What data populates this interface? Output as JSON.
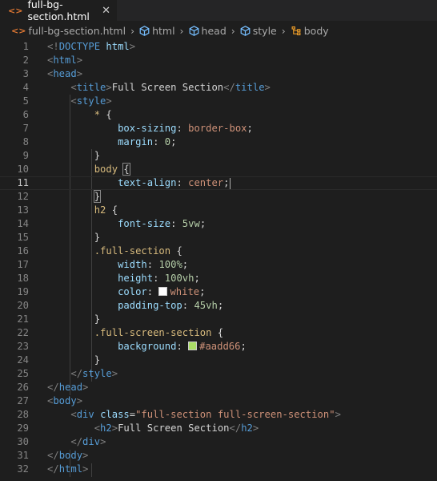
{
  "tab": {
    "filename": "full-bg-section.html",
    "file_icon": "html-file-icon",
    "close_icon": "close-icon",
    "close_glyph": "✕"
  },
  "breadcrumb": {
    "file": "full-bg-section.html",
    "items": [
      "html",
      "head",
      "style",
      "body"
    ],
    "separator": "›"
  },
  "colors": {
    "white_swatch": "#ffffff",
    "green_swatch": "#aadd66"
  },
  "editor": {
    "current_line": 11,
    "lines": [
      {
        "n": "1"
      },
      {
        "n": "2"
      },
      {
        "n": "3"
      },
      {
        "n": "4"
      },
      {
        "n": "5"
      },
      {
        "n": "6"
      },
      {
        "n": "7"
      },
      {
        "n": "8"
      },
      {
        "n": "9"
      },
      {
        "n": "10"
      },
      {
        "n": "11"
      },
      {
        "n": "12"
      },
      {
        "n": "13"
      },
      {
        "n": "14"
      },
      {
        "n": "15"
      },
      {
        "n": "16"
      },
      {
        "n": "17"
      },
      {
        "n": "18"
      },
      {
        "n": "19"
      },
      {
        "n": "20"
      },
      {
        "n": "21"
      },
      {
        "n": "22"
      },
      {
        "n": "23"
      },
      {
        "n": "24"
      },
      {
        "n": "25"
      },
      {
        "n": "26"
      },
      {
        "n": "27"
      },
      {
        "n": "28"
      },
      {
        "n": "29"
      },
      {
        "n": "30"
      },
      {
        "n": "31"
      },
      {
        "n": "32"
      }
    ],
    "tokens": {
      "doctype": "DOCTYPE",
      "html": "html",
      "head": "head",
      "title": "title",
      "title_text": "Full Screen Section",
      "style": "style",
      "star": "*",
      "box_sizing": "box-sizing",
      "border_box": "border-box",
      "margin": "margin",
      "zero": "0",
      "body": "body",
      "text_align": "text-align",
      "center": "center",
      "h2": "h2",
      "font_size": "font-size",
      "five_vw": "5vw",
      "full_section": ".full-section",
      "width": "width",
      "hundred_pct": "100%",
      "height": "height",
      "hundred_vh": "100vh",
      "color": "color",
      "white": "white",
      "padding_top": "padding-top",
      "fortyfive_vh": "45vh",
      "full_screen_section": ".full-screen-section",
      "background": "background",
      "green": "#aadd66",
      "div": "div",
      "class": "class",
      "class_val": "\"full-section full-screen-section\"",
      "h2_text": "Full Screen Section"
    }
  }
}
